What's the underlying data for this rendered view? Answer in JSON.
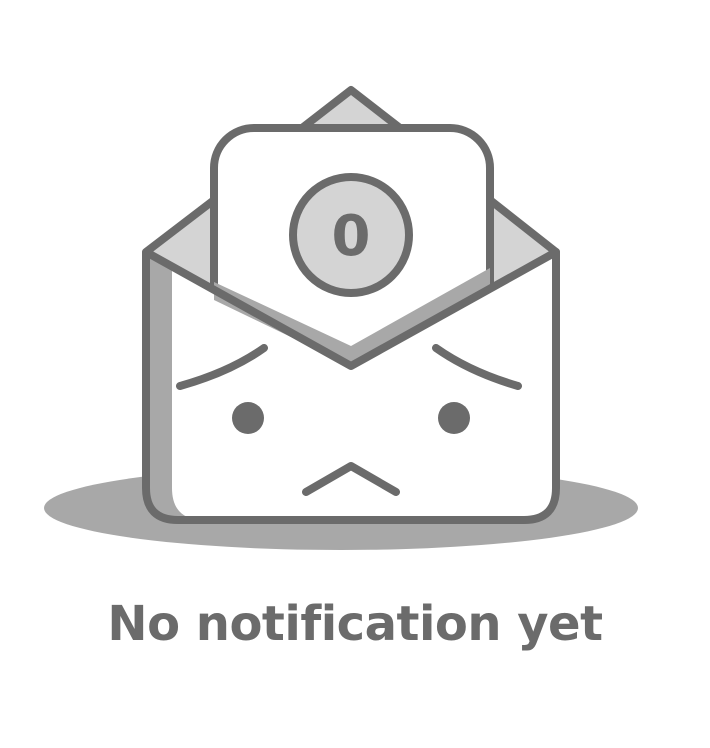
{
  "empty_state": {
    "message": "No notification yet",
    "badge_count": "0",
    "illustration_icon": "sad-open-envelope-icon"
  },
  "colors": {
    "stroke": "#6b6b6b",
    "flap_fill": "#d4d4d4",
    "shadow_fill": "#a8a8a8",
    "paper_fill": "#ffffff",
    "text": "#6b6b6b"
  }
}
